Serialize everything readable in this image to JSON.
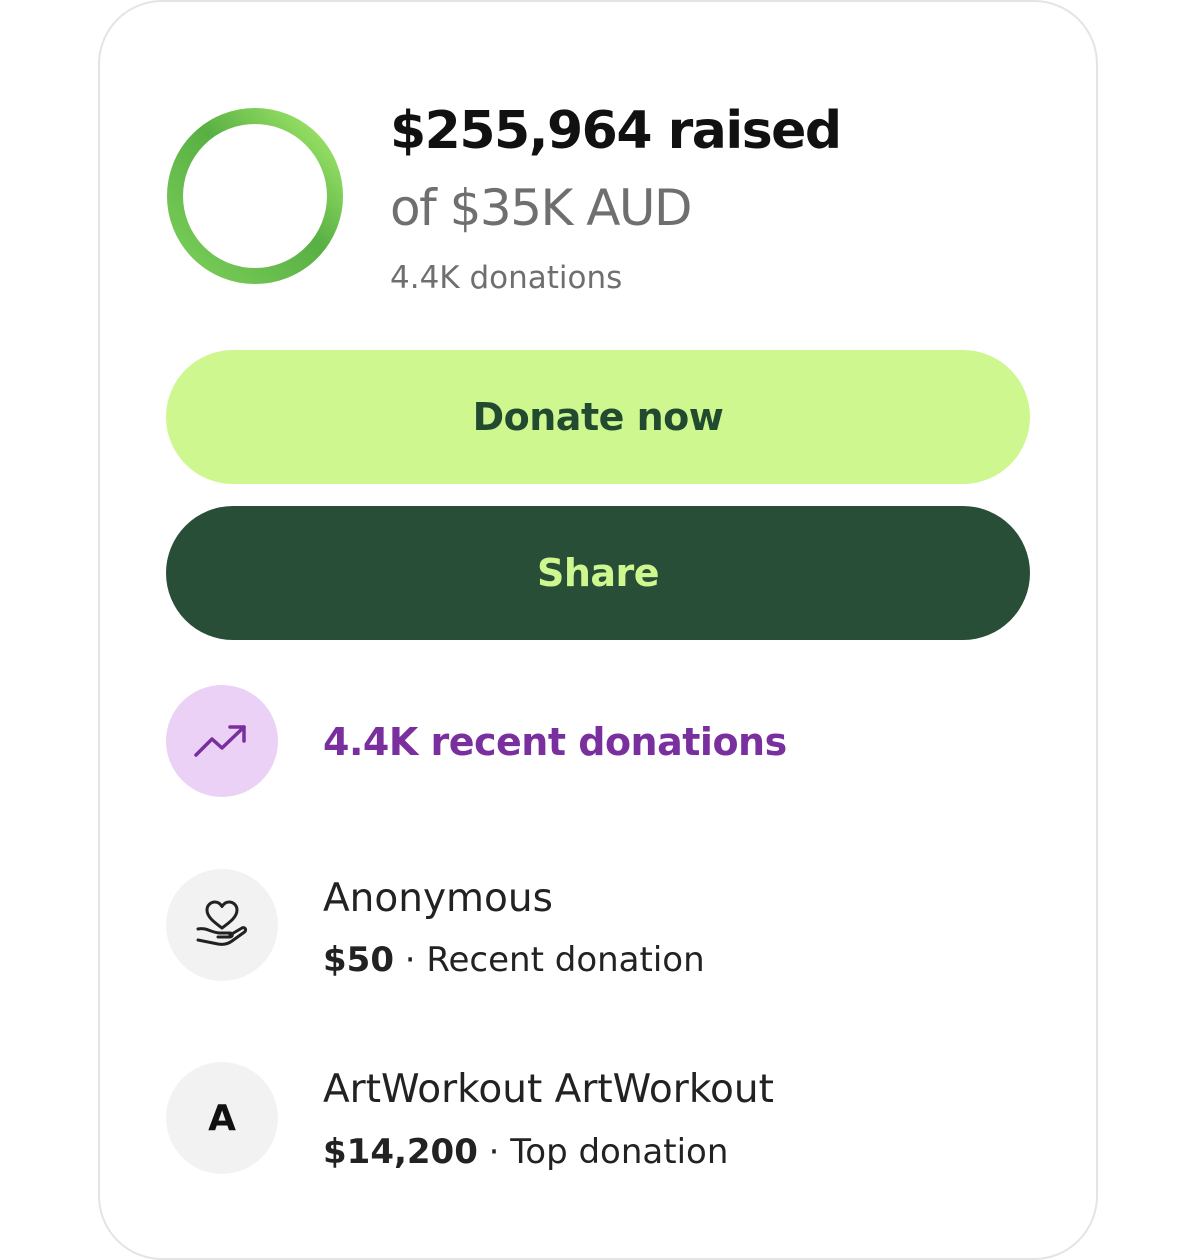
{
  "summary": {
    "raised_text": "$255,964 raised",
    "goal_text": "of $35K AUD",
    "donations_count_text": "4.4K donations",
    "progress_fraction": 1.0
  },
  "buttons": {
    "donate_label": "Donate now",
    "share_label": "Share"
  },
  "recent": {
    "label": "4.4K recent donations",
    "icon": "trending-up-icon"
  },
  "donations": [
    {
      "name": "Anonymous",
      "amount": "$50",
      "separator": " · ",
      "type": "Recent donation",
      "icon": "heart-in-hand-icon"
    },
    {
      "name": "ArtWorkout ArtWorkout",
      "amount": "$14,200",
      "separator": " · ",
      "type": "Top donation",
      "avatar_initial": "A"
    }
  ],
  "colors": {
    "donate_bg": "#cef78f",
    "donate_text": "#214a30",
    "share_bg": "#294e38",
    "share_text": "#cef78f",
    "recent_text": "#7a2f9e",
    "recent_circle": "#ebd1f5",
    "ring_green_dark": "#4c9e3f",
    "ring_green_light": "#a8ec6e"
  }
}
